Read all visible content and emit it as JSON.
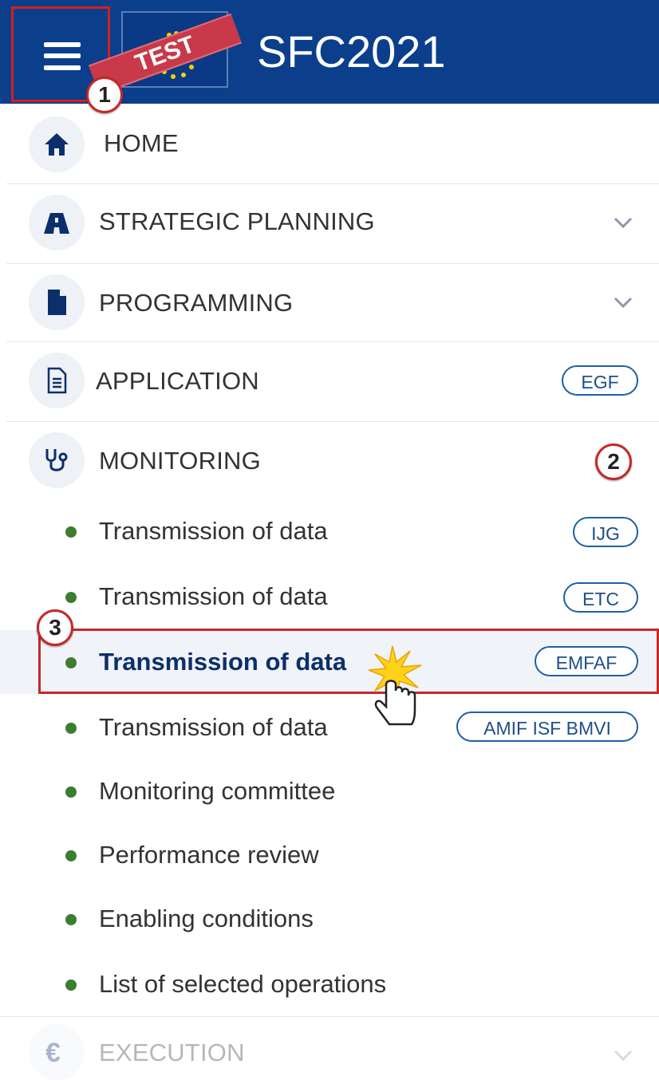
{
  "header": {
    "app_title": "SFC2021",
    "test_label": "TEST",
    "colors": {
      "background": "#0b3f8c",
      "highlight": "#c62828"
    }
  },
  "steps": [
    "1",
    "2",
    "3"
  ],
  "menu": {
    "home": {
      "label": "HOME",
      "icon": "home-icon"
    },
    "strategic_planning": {
      "label": "STRATEGIC PLANNING",
      "icon": "road-icon"
    },
    "programming": {
      "label": "PROGRAMMING",
      "icon": "document-icon"
    },
    "application": {
      "label": "APPLICATION",
      "icon": "file-text-icon",
      "tag": "EGF"
    },
    "monitoring": {
      "label": "MONITORING",
      "icon": "stethoscope-icon",
      "items": [
        {
          "label": "Transmission of data",
          "tag": "IJG"
        },
        {
          "label": "Transmission of data",
          "tag": "ETC"
        },
        {
          "label": "Transmission of data",
          "tag": "EMFAF"
        },
        {
          "label": "Transmission of data",
          "tag": "AMIF ISF BMVI"
        },
        {
          "label": "Monitoring committee"
        },
        {
          "label": "Performance review"
        },
        {
          "label": "Enabling conditions"
        },
        {
          "label": "List of selected operations"
        }
      ]
    },
    "execution": {
      "label": "EXECUTION",
      "icon": "euro-icon"
    }
  }
}
